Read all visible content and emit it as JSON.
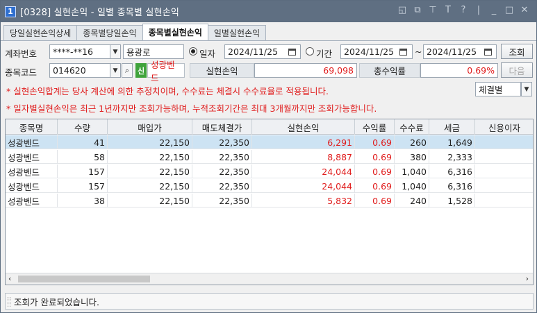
{
  "window": {
    "number": "1",
    "title": "[0328] 실현손익 - 일별 종목별 실현손익"
  },
  "tabs": [
    "당일실현손익상세",
    "종목별당일손익",
    "종목별실현손익",
    "일별실현손익"
  ],
  "form": {
    "account_label": "계좌번호",
    "account_value": "****-**16",
    "account_name": "용광로",
    "radio_date_label": "일자",
    "date_value": "2024/11/25",
    "radio_period_label": "기간",
    "period_from": "2024/11/25",
    "period_sep": "~",
    "period_to": "2024/11/25",
    "query_button": "조회",
    "code_label": "종목코드",
    "code_value": "014620",
    "credit_badge": "신",
    "stock_name": "성광벤드",
    "realized_label": "실현손익",
    "realized_value": "69,098",
    "total_rate_label": "총수익률",
    "total_rate_value": "0.69%",
    "next_button": "다음",
    "select_value": "체결별"
  },
  "notes": [
    "* 실현손익합계는 당사 계산에 의한 추정치이며, 수수료는 체결시 수수료율로 적용됩니다.",
    "* 일자별실현손익은 최근 1년까지만 조회가능하며, 누적조회기간은 최대 3개월까지만 조회가능합니다."
  ],
  "table": {
    "columns": [
      "종목명",
      "수량",
      "매입가",
      "매도체결가",
      "실현손익",
      "수익률",
      "수수료",
      "세금",
      "신용이자"
    ],
    "rows": [
      [
        "성광벤드",
        "41",
        "22,150",
        "22,350",
        "6,291",
        "0.69",
        "260",
        "1,649",
        ""
      ],
      [
        "성광벤드",
        "58",
        "22,150",
        "22,350",
        "8,887",
        "0.69",
        "380",
        "2,333",
        ""
      ],
      [
        "성광벤드",
        "157",
        "22,150",
        "22,350",
        "24,044",
        "0.69",
        "1,040",
        "6,316",
        ""
      ],
      [
        "성광벤드",
        "157",
        "22,150",
        "22,350",
        "24,044",
        "0.69",
        "1,040",
        "6,316",
        ""
      ],
      [
        "성광벤드",
        "38",
        "22,150",
        "22,350",
        "5,832",
        "0.69",
        "240",
        "1,528",
        ""
      ]
    ]
  },
  "status": "조회가 완료되었습니다.",
  "colors": {
    "titlebar": "#5f6f82",
    "profit_red": "#e01b1b",
    "selected_row": "#cde3f3"
  }
}
